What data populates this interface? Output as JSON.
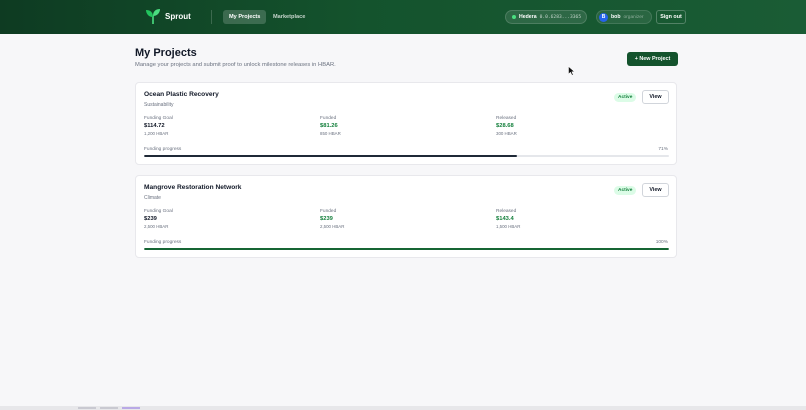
{
  "header": {
    "brand": "Sprout",
    "nav": [
      {
        "label": "My Projects",
        "active": true
      },
      {
        "label": "Marketplace",
        "active": false
      }
    ],
    "network": {
      "name": "Hedera",
      "account": "0.0.6283...3365",
      "status_color": "#4ade80"
    },
    "user": {
      "initial": "B",
      "name": "bob",
      "role": "organizer"
    },
    "signout_label": "Sign out"
  },
  "page": {
    "title": "My Projects",
    "subtitle": "Manage your projects and submit proof to unlock milestone releases in HBAR.",
    "new_project_label": "+ New Project"
  },
  "labels": {
    "funding_goal": "Funding Goal",
    "funded": "Funded",
    "released": "Released",
    "progress": "Funding progress",
    "view": "View"
  },
  "projects": [
    {
      "name": "Ocean Plastic Recovery",
      "category": "Sustainability",
      "status": "Active",
      "goal_usd": "$114.72",
      "goal_hbar": "1,200 HBAR",
      "funded_usd": "$81.26",
      "funded_hbar": "850 HBAR",
      "released_usd": "$28.68",
      "released_hbar": "300 HBAR",
      "progress_text": "71%",
      "progress": 71
    },
    {
      "name": "Mangrove Restoration Network",
      "category": "Climate",
      "status": "Active",
      "goal_usd": "$239",
      "goal_hbar": "2,500 HBAR",
      "funded_usd": "$239",
      "funded_hbar": "2,500 HBAR",
      "released_usd": "$143.4",
      "released_hbar": "1,500 HBAR",
      "progress_text": "100%",
      "progress": 100
    }
  ],
  "colors": {
    "brand_green": "#14532d",
    "accent_green": "#15803d",
    "badge_bg": "#dcfce7"
  }
}
